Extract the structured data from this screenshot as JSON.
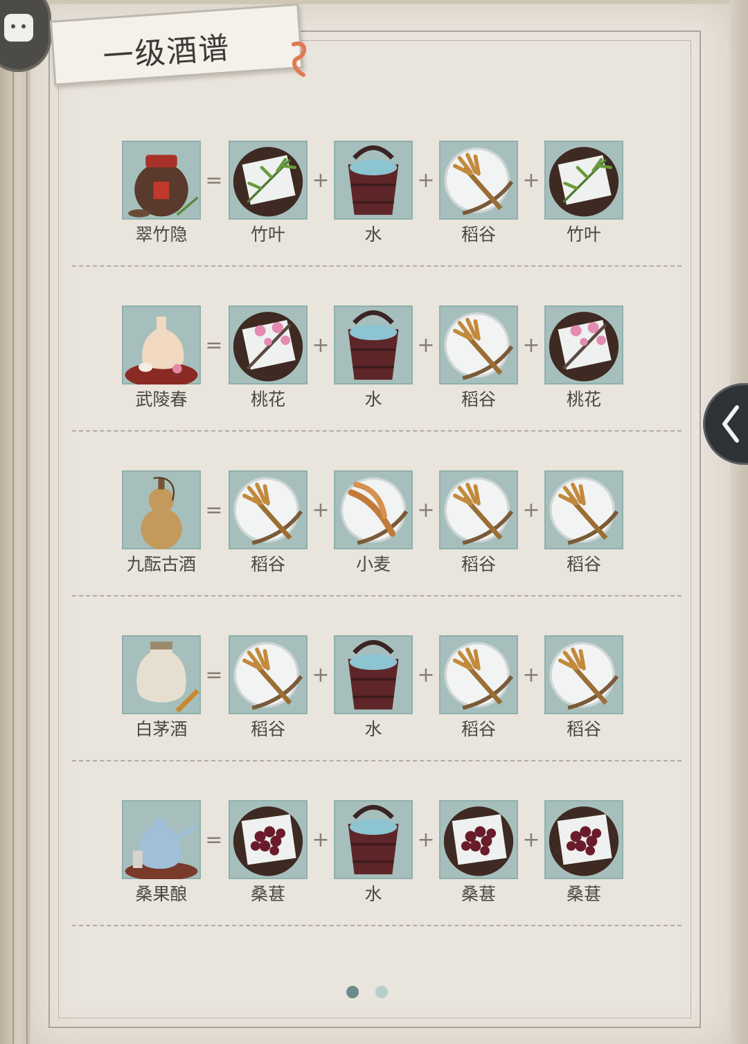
{
  "title": "一级酒谱",
  "operators": {
    "equals": "=",
    "plus": "+"
  },
  "recipes": [
    {
      "name": "翠竹隐",
      "icon": "wine-jar-icon",
      "ingredients": [
        {
          "name": "竹叶",
          "icon": "bamboo-leaf-icon"
        },
        {
          "name": "水",
          "icon": "water-bucket-icon"
        },
        {
          "name": "稻谷",
          "icon": "rice-grain-icon"
        },
        {
          "name": "竹叶",
          "icon": "bamboo-leaf-icon"
        }
      ]
    },
    {
      "name": "武陵春",
      "icon": "porcelain-wine-bottle-icon",
      "ingredients": [
        {
          "name": "桃花",
          "icon": "peach-blossom-icon"
        },
        {
          "name": "水",
          "icon": "water-bucket-icon"
        },
        {
          "name": "稻谷",
          "icon": "rice-grain-icon"
        },
        {
          "name": "桃花",
          "icon": "peach-blossom-icon"
        }
      ]
    },
    {
      "name": "九酝古酒",
      "icon": "gourd-flask-icon",
      "ingredients": [
        {
          "name": "稻谷",
          "icon": "rice-grain-icon"
        },
        {
          "name": "小麦",
          "icon": "wheat-icon"
        },
        {
          "name": "稻谷",
          "icon": "rice-grain-icon"
        },
        {
          "name": "稻谷",
          "icon": "rice-grain-icon"
        }
      ]
    },
    {
      "name": "白茅酒",
      "icon": "white-wine-jar-icon",
      "ingredients": [
        {
          "name": "稻谷",
          "icon": "rice-grain-icon"
        },
        {
          "name": "水",
          "icon": "water-bucket-icon"
        },
        {
          "name": "稻谷",
          "icon": "rice-grain-icon"
        },
        {
          "name": "稻谷",
          "icon": "rice-grain-icon"
        }
      ]
    },
    {
      "name": "桑果酿",
      "icon": "blue-porcelain-teapot-icon",
      "ingredients": [
        {
          "name": "桑葚",
          "icon": "mulberry-icon"
        },
        {
          "name": "水",
          "icon": "water-bucket-icon"
        },
        {
          "name": "桑葚",
          "icon": "mulberry-icon"
        },
        {
          "name": "桑葚",
          "icon": "mulberry-icon"
        }
      ]
    }
  ],
  "pager": {
    "pages": 2,
    "current": 1
  },
  "colors": {
    "tile": "#a6bfbc",
    "active_dot": "#6b8c8a",
    "inactive_dot": "#b6cdcb"
  }
}
